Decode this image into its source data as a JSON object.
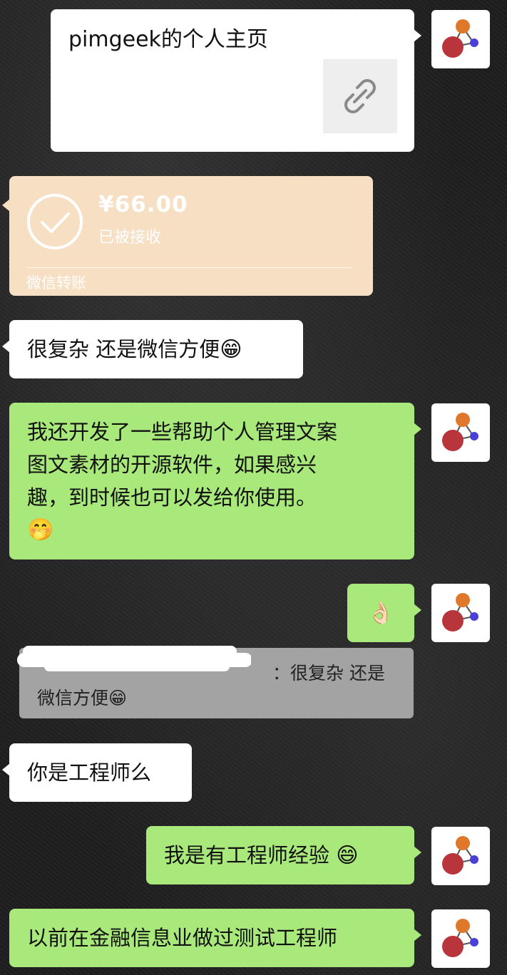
{
  "messages": {
    "link_card": {
      "title": "pimgeek的个人主页",
      "thumb_icon": "link-icon"
    },
    "transfer": {
      "amount": "¥66.00",
      "status": "已被接收",
      "label": "微信转账",
      "icon": "check-circle-icon"
    },
    "msg1": {
      "text": "很复杂 还是微信方便",
      "emoji": "😁"
    },
    "msg2": {
      "line1": "我还开发了一些帮助个人管理文案",
      "line2": "图文素材的开源软件，如果感兴",
      "line3": "趣，到时候也可以发给你使用。",
      "emoji": "🤭"
    },
    "msg3": {
      "emoji": "👌🏻"
    },
    "quote": {
      "text": "：很复杂 还是微信方便",
      "emoji": "😁"
    },
    "msg4": {
      "text": "你是工程师么"
    },
    "msg5": {
      "text": "我是有工程师经验 ",
      "emoji": "😄"
    },
    "msg6": {
      "text": "以前在金融信息业做过测试工程师"
    }
  },
  "colors": {
    "green_bubble": "#a9e87a",
    "white_bubble": "#ffffff",
    "transfer_bg": "#f7dfc3",
    "quote_bg": "#a3a3a3"
  }
}
